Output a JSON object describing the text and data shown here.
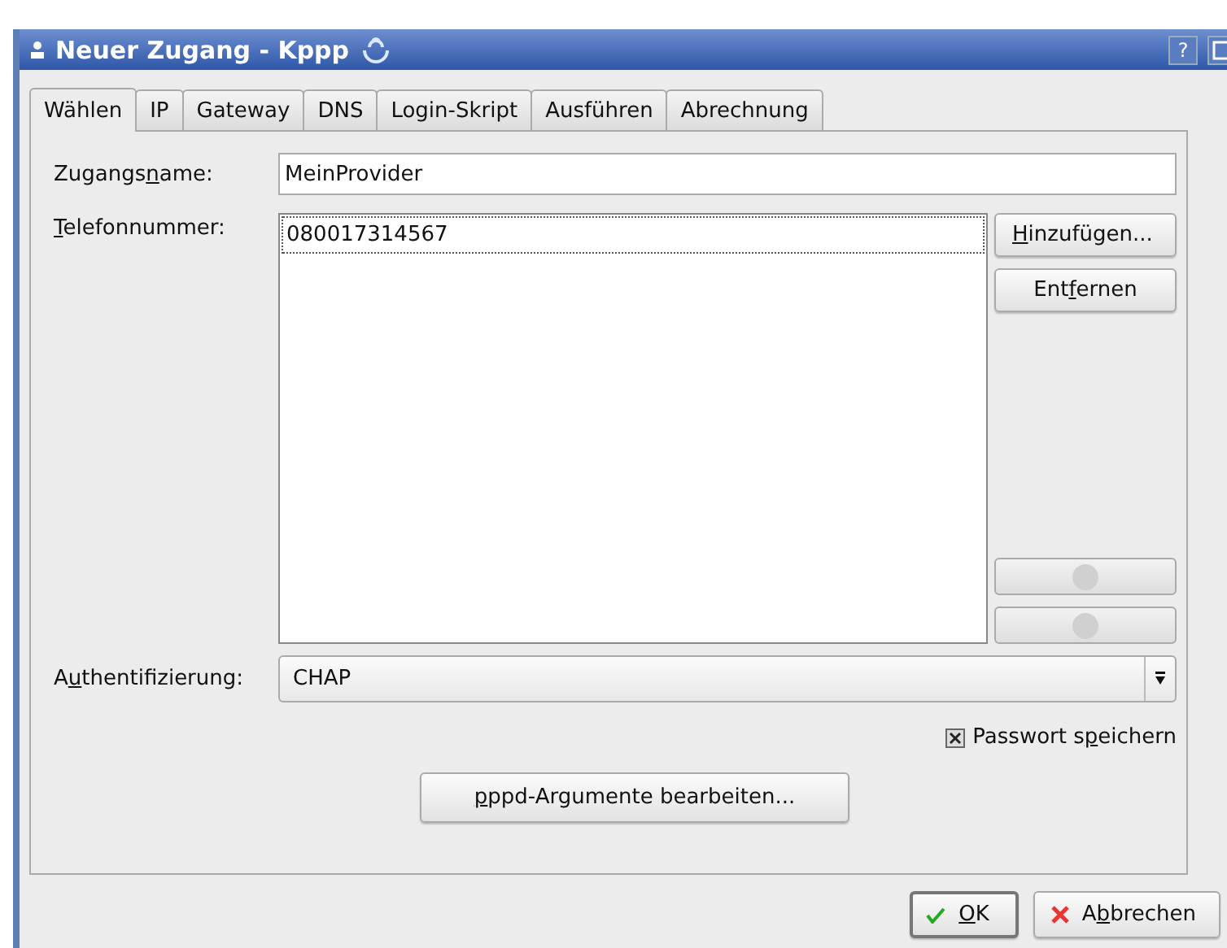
{
  "window": {
    "title": "Neuer Zugang - Kppp",
    "help": "?"
  },
  "tabs": [
    {
      "label": "Wählen",
      "selected": true
    },
    {
      "label": "IP",
      "selected": false
    },
    {
      "label": "Gateway",
      "selected": false
    },
    {
      "label": "DNS",
      "selected": false
    },
    {
      "label": "Login-Skript",
      "selected": false
    },
    {
      "label": "Ausführen",
      "selected": false
    },
    {
      "label": "Abrechnung",
      "selected": false
    }
  ],
  "account_name": {
    "label_parts": [
      "Zugangs",
      "n",
      "ame:"
    ],
    "value": "MeinProvider"
  },
  "phone": {
    "label_parts": [
      "T",
      "elefonnummer:"
    ],
    "numbers": [
      {
        "text": "080017314567",
        "selected": true
      }
    ],
    "buttons": [
      {
        "parts": [
          "H",
          "inzufügen..."
        ]
      },
      {
        "parts": [
          "Ent",
          "f",
          "ernen"
        ]
      }
    ],
    "move_up_disabled": true,
    "move_down_disabled": true
  },
  "authentication": {
    "label_parts": [
      "A",
      "u",
      "thentifizierung:"
    ],
    "value": "CHAP"
  },
  "save_password": {
    "label_parts": [
      "Passwort s",
      "p",
      "eichern"
    ],
    "checked": true
  },
  "pppd_button": {
    "parts": [
      "p",
      "ppd-Argumente bearbeiten..."
    ]
  },
  "footer_buttons": [
    {
      "kind": "ok",
      "parts": [
        "O",
        "K"
      ],
      "default": true
    },
    {
      "kind": "cancel",
      "parts": [
        "A",
        "b",
        "brechen"
      ],
      "default": false
    }
  ]
}
